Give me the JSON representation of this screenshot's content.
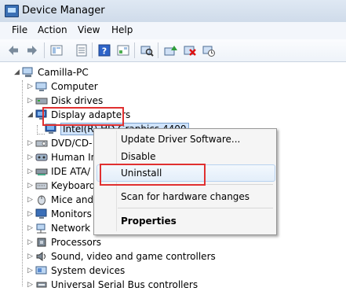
{
  "window": {
    "title": "Device Manager"
  },
  "menu": [
    "File",
    "Action",
    "View",
    "Help"
  ],
  "toolbar": {
    "icons": [
      "back-icon",
      "forward-icon",
      "tree-view-icon",
      "properties-icon",
      "help-icon",
      "view-icon",
      "scan-hardware-icon",
      "update-driver-icon",
      "uninstall-icon",
      "disable-icon"
    ]
  },
  "tree": {
    "root": "Camilla-PC",
    "items": [
      {
        "label": "Computer",
        "icon": "computer-icon"
      },
      {
        "label": "Disk drives",
        "icon": "disk-icon"
      },
      {
        "label": "Display adapters",
        "icon": "display-icon",
        "expanded": true
      },
      {
        "label": "Intel(R) HD Graphics 4400",
        "icon": "display-icon",
        "child": true,
        "selected": true
      },
      {
        "label": "DVD/CD-",
        "icon": "dvd-icon"
      },
      {
        "label": "Human In",
        "icon": "hid-icon"
      },
      {
        "label": "IDE ATA/",
        "icon": "ide-icon"
      },
      {
        "label": "Keyboard",
        "icon": "keyboard-icon"
      },
      {
        "label": "Mice and",
        "icon": "mouse-icon"
      },
      {
        "label": "Monitors",
        "icon": "monitor-icon"
      },
      {
        "label": "Network a",
        "icon": "network-icon"
      },
      {
        "label": "Processors",
        "icon": "processor-icon"
      },
      {
        "label": "Sound, video and game controllers",
        "icon": "sound-icon"
      },
      {
        "label": "System devices",
        "icon": "system-icon"
      },
      {
        "label": "Universal Serial Bus controllers",
        "icon": "usb-icon"
      }
    ]
  },
  "context_menu": {
    "update": "Update Driver Software...",
    "disable": "Disable",
    "uninstall": "Uninstall",
    "scan": "Scan for hardware changes",
    "properties": "Properties"
  },
  "colors": {
    "highlight": "#e03030",
    "selection": "#cfe3fb"
  }
}
